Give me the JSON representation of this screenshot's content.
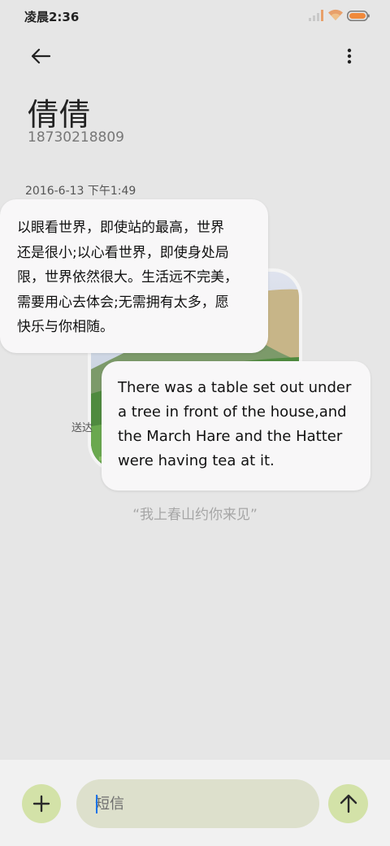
{
  "status_bar": {
    "time": "凌晨2:36",
    "signal_icon": "signal-icon",
    "wifi_icon": "wifi-icon",
    "battery_icon": "battery-icon",
    "battery_color": "#f08a3c"
  },
  "header": {
    "back_icon": "back-arrow-icon",
    "more_icon": "more-vert-icon",
    "contact_name": "倩倩",
    "contact_number": "18730218809"
  },
  "conversation": {
    "timestamp": "2016-6-13 下午1:49",
    "bubble_cn_lines": [
      "以眼看世界，即使站的最高，世界",
      "还是很小;以心看世界，即使身处局",
      "限，世界依然很大。生活远不完美，",
      "需要用心去体会;无需拥有太多，愿",
      "快乐与你相随。"
    ],
    "bubble_en_lines": [
      "There was a table set out under",
      "a tree in front of the house,and",
      "the March Hare and the Hatter",
      "were having tea at it."
    ],
    "sent_status": "送达",
    "quote": "“我上春山约你来见”"
  },
  "composer": {
    "add_icon": "plus-icon",
    "input_placeholder": "短信",
    "input_value": "",
    "send_icon": "arrow-up-icon",
    "accent_color": "#d3e2a8"
  }
}
